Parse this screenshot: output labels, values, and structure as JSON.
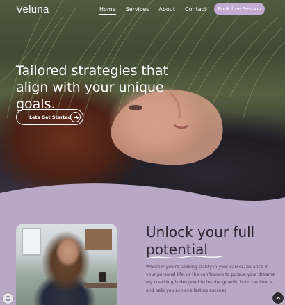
{
  "brand": {
    "logo": "Veluna"
  },
  "nav": {
    "items": [
      {
        "label": "Home",
        "active": true
      },
      {
        "label": "Services",
        "active": false
      },
      {
        "label": "About",
        "active": false
      },
      {
        "label": "Contact",
        "active": false
      }
    ],
    "book_label": "Book free Session"
  },
  "hero": {
    "headline": "Tailored strategies that align with your unique goals.",
    "cta_label": "Lets Get Started"
  },
  "intro": {
    "heading_line1": "Unlock your full",
    "heading_line2": "potential",
    "paragraph": "Whether you're seeking clarity in your career, balance in your personal life, or the confidence to pursue your dreams, my coaching is designed to inspire growth, build resilience, and help you achieve lasting success."
  },
  "colors": {
    "lavender": "#b9a8c5",
    "button": "#c3aad3",
    "dark_text": "#2d2632"
  },
  "icons": [
    "arrow-right-icon",
    "chevron-up-icon",
    "cookie-badge-icon",
    "underline-swirl-icon"
  ]
}
